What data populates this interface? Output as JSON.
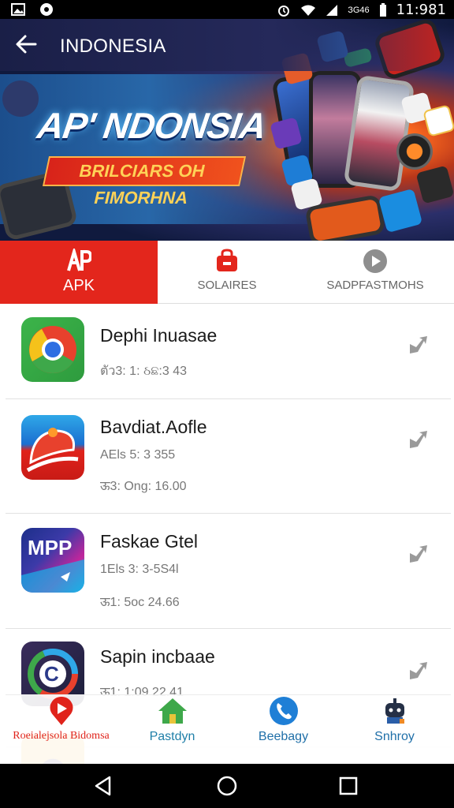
{
  "status_bar": {
    "network_label": "ЗG46",
    "time": "11:981",
    "icons": [
      "image-icon",
      "record-icon",
      "alarm-icon",
      "wifi-icon",
      "signal-icon",
      "battery-icon"
    ]
  },
  "header": {
    "title": "INDONESIA",
    "back_icon": "arrow-left-icon"
  },
  "hero": {
    "headline": "AP' NDONSIA",
    "subheadline": "BRILCIARS OH FIMORHNA"
  },
  "tabs": [
    {
      "label": "APK",
      "icon": "apk-icon",
      "active": true
    },
    {
      "label": "SOLAIRES",
      "icon": "bag-icon",
      "active": false
    },
    {
      "label": "SADPFASTMOHS",
      "icon": "play-icon",
      "active": false
    }
  ],
  "apps": [
    {
      "name": "Dephi Inuasae",
      "meta": [
        "ตัว3: 1: ઠଛ:3 43"
      ],
      "icon": "chrome-like-icon"
    },
    {
      "name": "Bavdiat.Aofle",
      "meta": [
        "AEls 5: 3 355",
        "ऊ3: Ong: 16.00"
      ],
      "icon": "red-cap-icon"
    },
    {
      "name": "Faskae Gtel",
      "meta": [
        "1Els 3: 3-5S4l",
        "ऊ1: 5oc 24.66"
      ],
      "icon": "mpp-icon"
    },
    {
      "name": "Sapin incbaae",
      "meta": [
        "ऊ1: 1:09 22.41"
      ],
      "icon": "c-logo-icon"
    }
  ],
  "bottom_nav": [
    {
      "label": "Roeialejsola Bidomsa",
      "icon": "play-pin-icon",
      "color": "#e0231b"
    },
    {
      "label": "Pastdyn",
      "icon": "house-icon",
      "color": "#1f7fa8"
    },
    {
      "label": "Beebagy",
      "icon": "phone-icon",
      "color": "#1f6fa8"
    },
    {
      "label": "Snhroy",
      "icon": "robot-icon",
      "color": "#1f6fa8"
    }
  ],
  "colors": {
    "accent_red": "#e3261c",
    "hero_blue": "#1c4e8c"
  }
}
